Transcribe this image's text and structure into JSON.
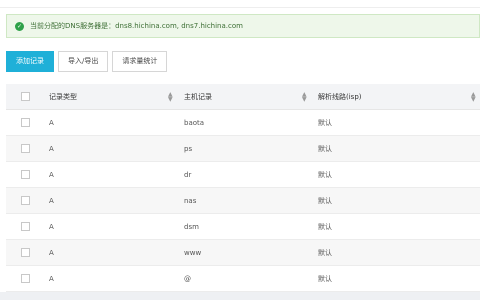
{
  "notice": {
    "text": "当前分配的DNS服务器是：dns8.hichina.com, dns7.hichina.com"
  },
  "toolbar": {
    "add_label": "添加记录",
    "import_label": "导入/导出",
    "stats_label": "请求量统计"
  },
  "table": {
    "headers": {
      "type": "记录类型",
      "host": "主机记录",
      "isp": "解析线路(isp)"
    },
    "rows": [
      {
        "type": "A",
        "host": "baota",
        "isp": "默认"
      },
      {
        "type": "A",
        "host": "ps",
        "isp": "默认"
      },
      {
        "type": "A",
        "host": "dr",
        "isp": "默认"
      },
      {
        "type": "A",
        "host": "nas",
        "isp": "默认"
      },
      {
        "type": "A",
        "host": "dsm",
        "isp": "默认"
      },
      {
        "type": "A",
        "host": "www",
        "isp": "默认"
      },
      {
        "type": "A",
        "host": "@",
        "isp": "默认"
      }
    ]
  },
  "colors": {
    "primary": "#1fb0d8",
    "success": "#2fa14a",
    "notice_bg": "#eef7ea"
  },
  "icons": {
    "notice": "check-circle-icon",
    "sort": "sort-arrows-icon"
  }
}
